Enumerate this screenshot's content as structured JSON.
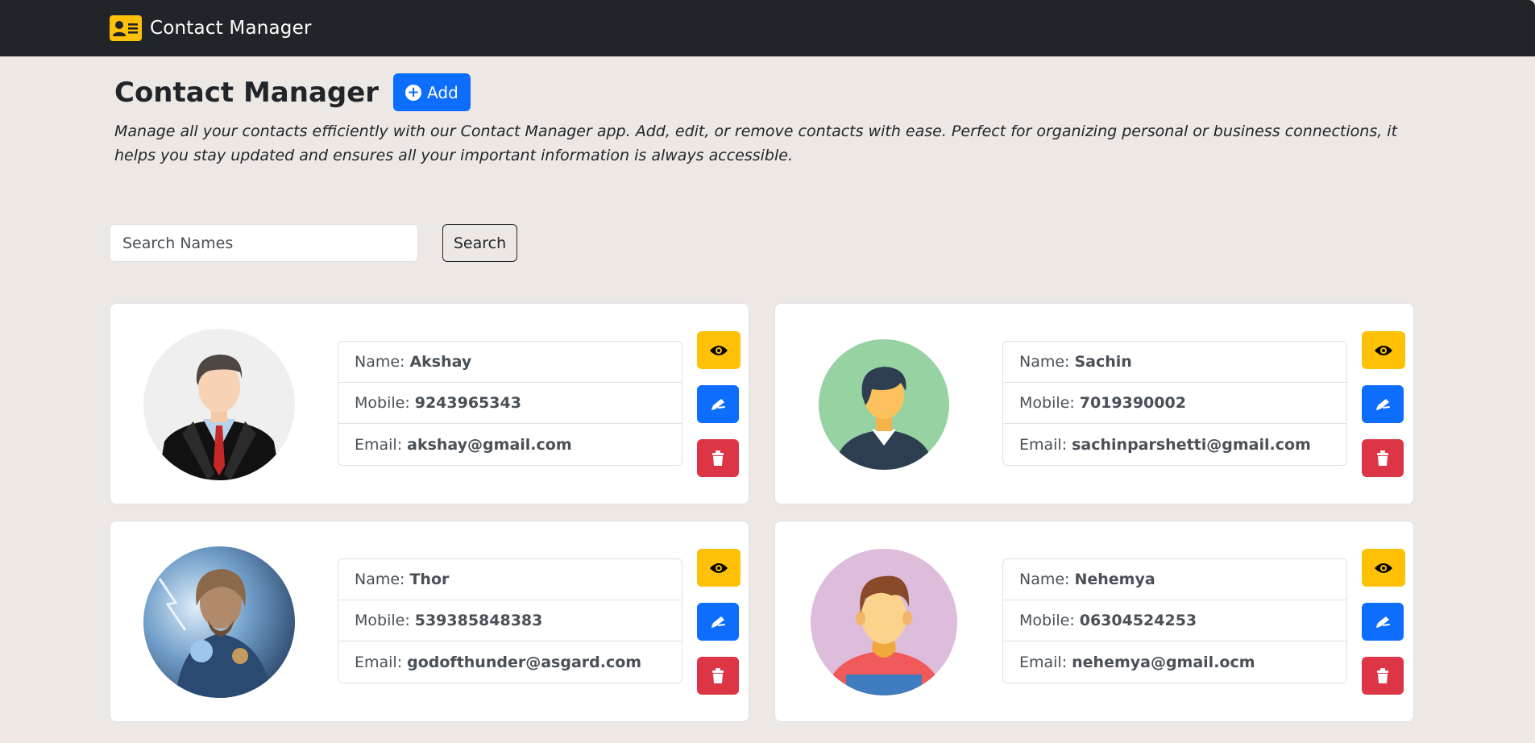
{
  "navbar": {
    "brand_icon": "contact-card-icon",
    "brand_text": "Contact Manager"
  },
  "header": {
    "title": "Contact Manager",
    "add_label": "Add",
    "add_icon": "plus-circle-icon",
    "description": "Manage all your contacts efficiently with our Contact Manager app. Add, edit, or remove contacts with ease. Perfect for organizing personal or business connections, it helps you stay updated and ensures all your important information is always accessible."
  },
  "search": {
    "placeholder": "Search Names",
    "value": "",
    "button_label": "Search"
  },
  "labels": {
    "name": "Name:",
    "mobile": "Mobile:",
    "email": "Email:"
  },
  "actions": {
    "view_icon": "eye-icon",
    "edit_icon": "pen-icon",
    "delete_icon": "trash-icon"
  },
  "contacts": [
    {
      "name": "Akshay",
      "mobile": "9243965343",
      "email": "akshay@gmail.com",
      "avatar": "businessman-avatar"
    },
    {
      "name": "Sachin",
      "mobile": "7019390002",
      "email": "sachinparshetti@gmail.com",
      "avatar": "young-man-avatar"
    },
    {
      "name": "Thor",
      "mobile": "539385848383",
      "email": "godofthunder@asgard.com",
      "avatar": "thor-photo"
    },
    {
      "name": "Nehemya",
      "mobile": "06304524253",
      "email": "nehemya@gmail.ocm",
      "avatar": "casual-man-avatar"
    }
  ],
  "colors": {
    "navbar_bg": "#212529",
    "page_bg": "#ede8e4",
    "primary": "#0d6efd",
    "warning": "#ffc107",
    "danger": "#dc3545"
  }
}
